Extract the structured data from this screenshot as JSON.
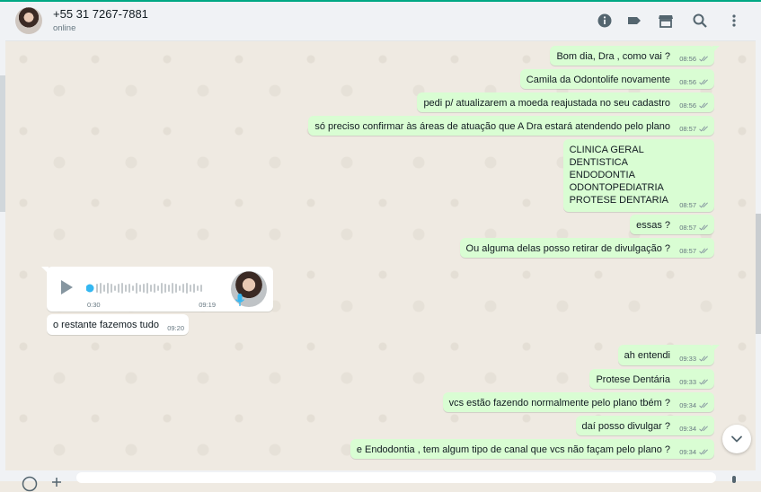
{
  "header": {
    "contact_name": "+55 31 7267-7881",
    "status": "online",
    "icons": [
      "info-icon",
      "label-icon",
      "catalog-icon",
      "search-icon",
      "menu-icon"
    ]
  },
  "colors": {
    "accent": "#00a884",
    "outgoing_bubble": "#d9fdd3",
    "incoming_bubble": "#ffffff",
    "chat_bg": "#efeae2",
    "read_ticks": "#8696a0"
  },
  "messages": [
    {
      "text": "Bom dia, Dra , como vai ?",
      "time": "08:56"
    },
    {
      "text": "Camila da Odontolife novamente",
      "time": "08:56"
    },
    {
      "text": "pedi p/ atualizarem a moeda reajustada no seu cadastro",
      "time": "08:56"
    },
    {
      "text": "só preciso confirmar às áreas de atuação que A Dra estará atendendo pelo plano",
      "time": "08:57"
    },
    {
      "lines": [
        "CLINICA GERAL",
        "DENTISTICA",
        "ENDODONTIA",
        "ODONTOPEDIATRIA",
        "PROTESE DENTARIA"
      ],
      "time": "08:57"
    },
    {
      "text": "essas ?",
      "time": "08:57"
    },
    {
      "text": "Ou alguma delas posso retirar de divulgação ?",
      "time": "08:57"
    },
    {
      "duration": "0:30",
      "time": "09:19"
    },
    {
      "text": "o restante fazemos tudo",
      "time": "09:20"
    },
    {
      "text": "ah entendi",
      "time": "09:33"
    },
    {
      "text": "Protese Dentária",
      "time": "09:33"
    },
    {
      "text": "vcs estão fazendo normalmente pelo plano tbém ?",
      "time": "09:34"
    },
    {
      "text": "daí posso divulgar ?",
      "time": "09:34"
    },
    {
      "text": "e Endodontia , tem algum tipo de canal que vcs não façam pelo plano ?",
      "time": "09:34"
    }
  ]
}
